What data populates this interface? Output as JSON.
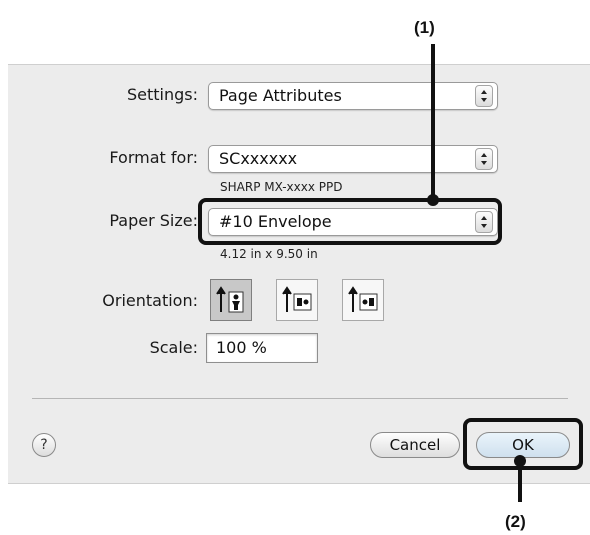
{
  "dialog": {
    "settings": {
      "label": "Settings:",
      "value": "Page Attributes"
    },
    "format_for": {
      "label": "Format for:",
      "value": "SCxxxxxx",
      "sub": "SHARP MX-xxxx PPD"
    },
    "paper_size": {
      "label": "Paper Size:",
      "value": "#10 Envelope",
      "sub": "4.12 in x 9.50 in"
    },
    "orientation": {
      "label": "Orientation:",
      "options": [
        "portrait",
        "landscape-left",
        "landscape-right"
      ],
      "selected": "portrait"
    },
    "scale": {
      "label": "Scale:",
      "value": "100 %"
    },
    "help_label": "?",
    "cancel_label": "Cancel",
    "ok_label": "OK"
  },
  "callouts": {
    "one": "(1)",
    "two": "(2)"
  }
}
